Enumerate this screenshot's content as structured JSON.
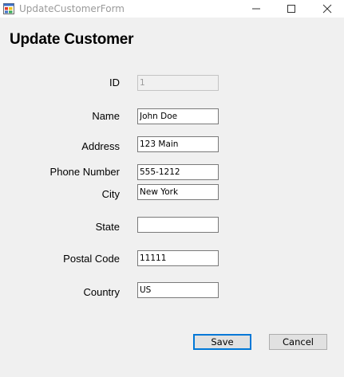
{
  "window": {
    "title": "UpdateCustomerForm",
    "icon": "winforms-app-icon",
    "controls": [
      "minimize-icon",
      "maximize-icon",
      "close-icon"
    ]
  },
  "form": {
    "heading": "Update Customer",
    "fields": {
      "id": {
        "label": "ID",
        "value": "1",
        "enabled": false
      },
      "name": {
        "label": "Name",
        "value": "John Doe"
      },
      "address": {
        "label": "Address",
        "value": "123 Main"
      },
      "phone": {
        "label": "Phone Number",
        "value": "555-1212"
      },
      "city": {
        "label": "City",
        "value": "New York"
      },
      "state": {
        "label": "State",
        "value": ""
      },
      "postal": {
        "label": "Postal Code",
        "value": "11111"
      },
      "country": {
        "label": "Country",
        "value": "US"
      }
    },
    "buttons": {
      "save": "Save",
      "cancel": "Cancel"
    }
  },
  "colors": {
    "background": "#f0f0f0",
    "focus_border": "#0078d7"
  }
}
